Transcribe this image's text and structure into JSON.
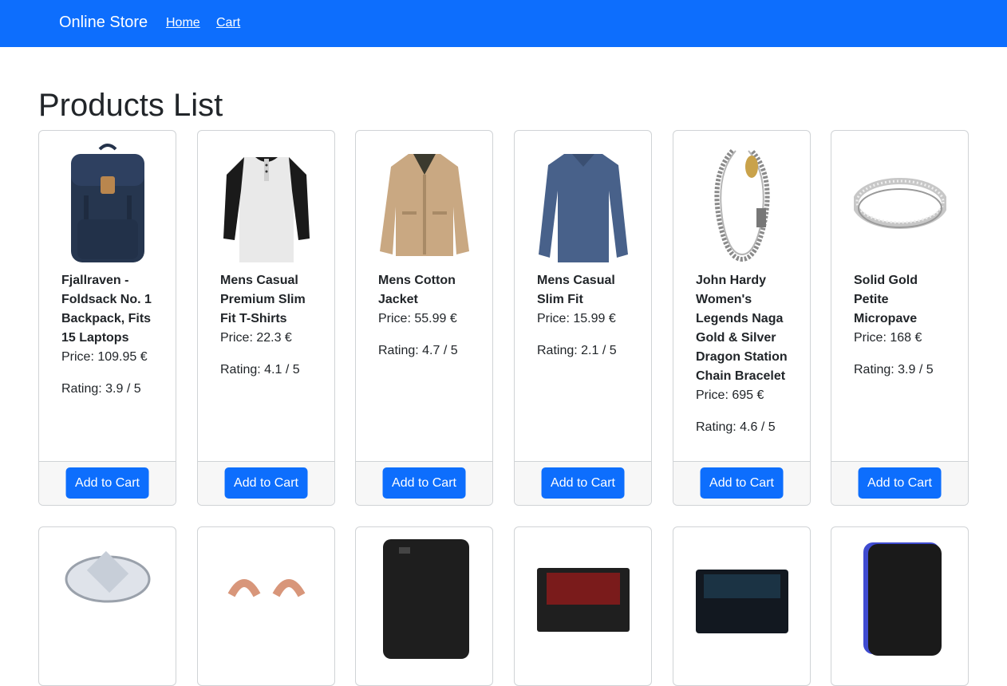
{
  "navbar": {
    "brand": "Online Store",
    "links": [
      "Home",
      "Cart"
    ],
    "color": "#0d6efd"
  },
  "page": {
    "title": "Products List"
  },
  "products": [
    {
      "title": "Fjallraven - Foldsack No. 1 Backpack, Fits 15 Laptops",
      "price": "Price: 109.95 €",
      "rating": "Rating: 3.9 / 5",
      "button": "Add to Cart",
      "image": "backpack-image"
    },
    {
      "title": "Mens Casual Premium Slim Fit T-Shirts",
      "price": "Price: 22.3 €",
      "rating": "Rating: 4.1 / 5",
      "button": "Add to Cart",
      "image": "tshirt-image"
    },
    {
      "title": "Mens Cotton Jacket",
      "price": "Price: 55.99 €",
      "rating": "Rating: 4.7 / 5",
      "button": "Add to Cart",
      "image": "jacket-image"
    },
    {
      "title": "Mens Casual Slim Fit",
      "price": "Price: 15.99 €",
      "rating": "Rating: 2.1 / 5",
      "button": "Add to Cart",
      "image": "longsleeve-image"
    },
    {
      "title": "John Hardy Women's Legends Naga Gold & Silver Dragon Station Chain Bracelet",
      "price": "Price: 695 €",
      "rating": "Rating: 4.6 / 5",
      "button": "Add to Cart",
      "image": "bracelet-image"
    },
    {
      "title": "Solid Gold Petite Micropave",
      "price": "Price: 168 €",
      "rating": "Rating: 3.9 / 5",
      "button": "Add to Cart",
      "image": "ring-image"
    }
  ],
  "products_row2": [
    {
      "image": "diamond-ring-image"
    },
    {
      "image": "rose-gold-earrings-image"
    },
    {
      "image": "external-hard-drive-image"
    },
    {
      "image": "ssd-image"
    },
    {
      "image": "ssd-dark-image"
    },
    {
      "image": "portable-drive-image"
    }
  ]
}
